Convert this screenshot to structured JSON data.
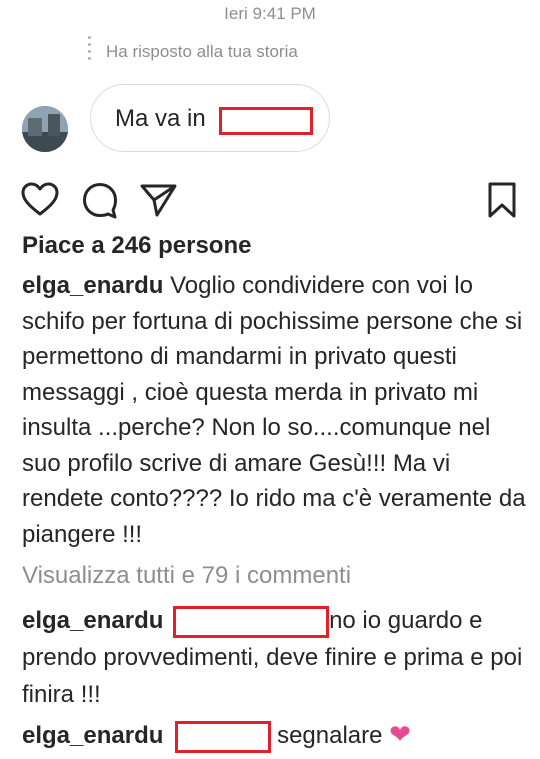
{
  "timestamp": "Ieri 9:41 PM",
  "story_reply": {
    "label": "Ha risposto alla tua storia"
  },
  "message": {
    "text": "Ma va in"
  },
  "actions": {
    "like_icon": "heart-outline",
    "comment_icon": "speech-bubble",
    "share_icon": "paper-plane",
    "save_icon": "bookmark"
  },
  "post": {
    "likes": "Piace a 246 persone",
    "caption_user": "elga_enardu",
    "caption_text": "Voglio condividere con voi lo schifo per fortuna di pochissime persone che si permettono di mandarmi in privato questi messaggi , cioè questa merda in privato  mi insulta ...perche? Non lo so....comunque nel suo profilo scrive di amare Gesù!!! Ma vi rendete conto???? Io rido ma c'è veramente da piangere !!!",
    "view_all": "Visualizza tutti e 79 i commenti"
  },
  "comments": [
    {
      "user": "elga_enardu",
      "text": "no io guardo e prendo provvedimenti, deve finire e prima e poi finira !!!"
    },
    {
      "user": "elga_enardu",
      "text": "segnalare",
      "emoji": "❤"
    }
  ],
  "colors": {
    "redaction": "#e0202a",
    "heart": "#e84a8e",
    "muted": "#8e8e8e"
  }
}
